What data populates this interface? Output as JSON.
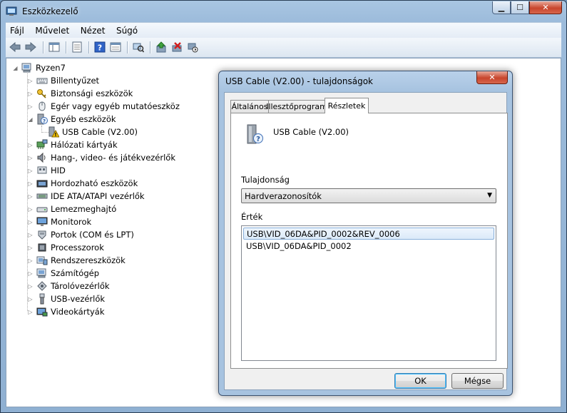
{
  "window": {
    "title": "Eszközkezelő"
  },
  "menu": [
    "Fájl",
    "Művelet",
    "Nézet",
    "Súgó"
  ],
  "tree": {
    "root": "Ryzen7",
    "items": [
      {
        "label": "Billentyűzet",
        "icon": "keyboard-icon"
      },
      {
        "label": "Biztonsági eszközök",
        "icon": "key-icon"
      },
      {
        "label": "Egér vagy egyéb mutatóeszköz",
        "icon": "mouse-icon"
      },
      {
        "label": "Egyéb eszközök",
        "icon": "unknown-device-icon",
        "expanded": true
      },
      {
        "label": "USB Cable (V2.00)",
        "icon": "warning-device-icon",
        "child": true
      },
      {
        "label": "Hálózati kártyák",
        "icon": "network-icon"
      },
      {
        "label": "Hang-, video- és játékvezérlők",
        "icon": "speaker-icon"
      },
      {
        "label": "HID",
        "icon": "hid-icon"
      },
      {
        "label": "Hordozható eszközök",
        "icon": "portable-device-icon"
      },
      {
        "label": "IDE ATA/ATAPI vezérlők",
        "icon": "ide-icon"
      },
      {
        "label": "Lemezmeghajtó",
        "icon": "disk-icon"
      },
      {
        "label": "Monitorok",
        "icon": "monitor-icon"
      },
      {
        "label": "Portok (COM és LPT)",
        "icon": "port-icon"
      },
      {
        "label": "Processzorok",
        "icon": "cpu-icon"
      },
      {
        "label": "Rendszereszközök",
        "icon": "system-icon"
      },
      {
        "label": "Számítógép",
        "icon": "computer-icon"
      },
      {
        "label": "Tárolóvezérlők",
        "icon": "storage-icon"
      },
      {
        "label": "USB-vezérlők",
        "icon": "usb-icon"
      },
      {
        "label": "Videokártyák",
        "icon": "display-adapter-icon"
      }
    ]
  },
  "dialog": {
    "title": "USB Cable (V2.00) - tulajdonságok",
    "tabs": [
      "Általános",
      "Illesztőprogram",
      "Részletek"
    ],
    "active_tab": "Részletek",
    "device_name": "USB Cable (V2.00)",
    "property_label": "Tulajdonság",
    "property_value": "Hardverazonosítók",
    "value_label": "Érték",
    "values": [
      "USB\\VID_06DA&PID_0002&REV_0006",
      "USB\\VID_06DA&PID_0002"
    ],
    "ok_label": "OK",
    "cancel_label": "Mégse"
  },
  "colors": {
    "accent": "#3c7fb1",
    "close_button": "#c8452c",
    "warning": "#f2c200"
  }
}
